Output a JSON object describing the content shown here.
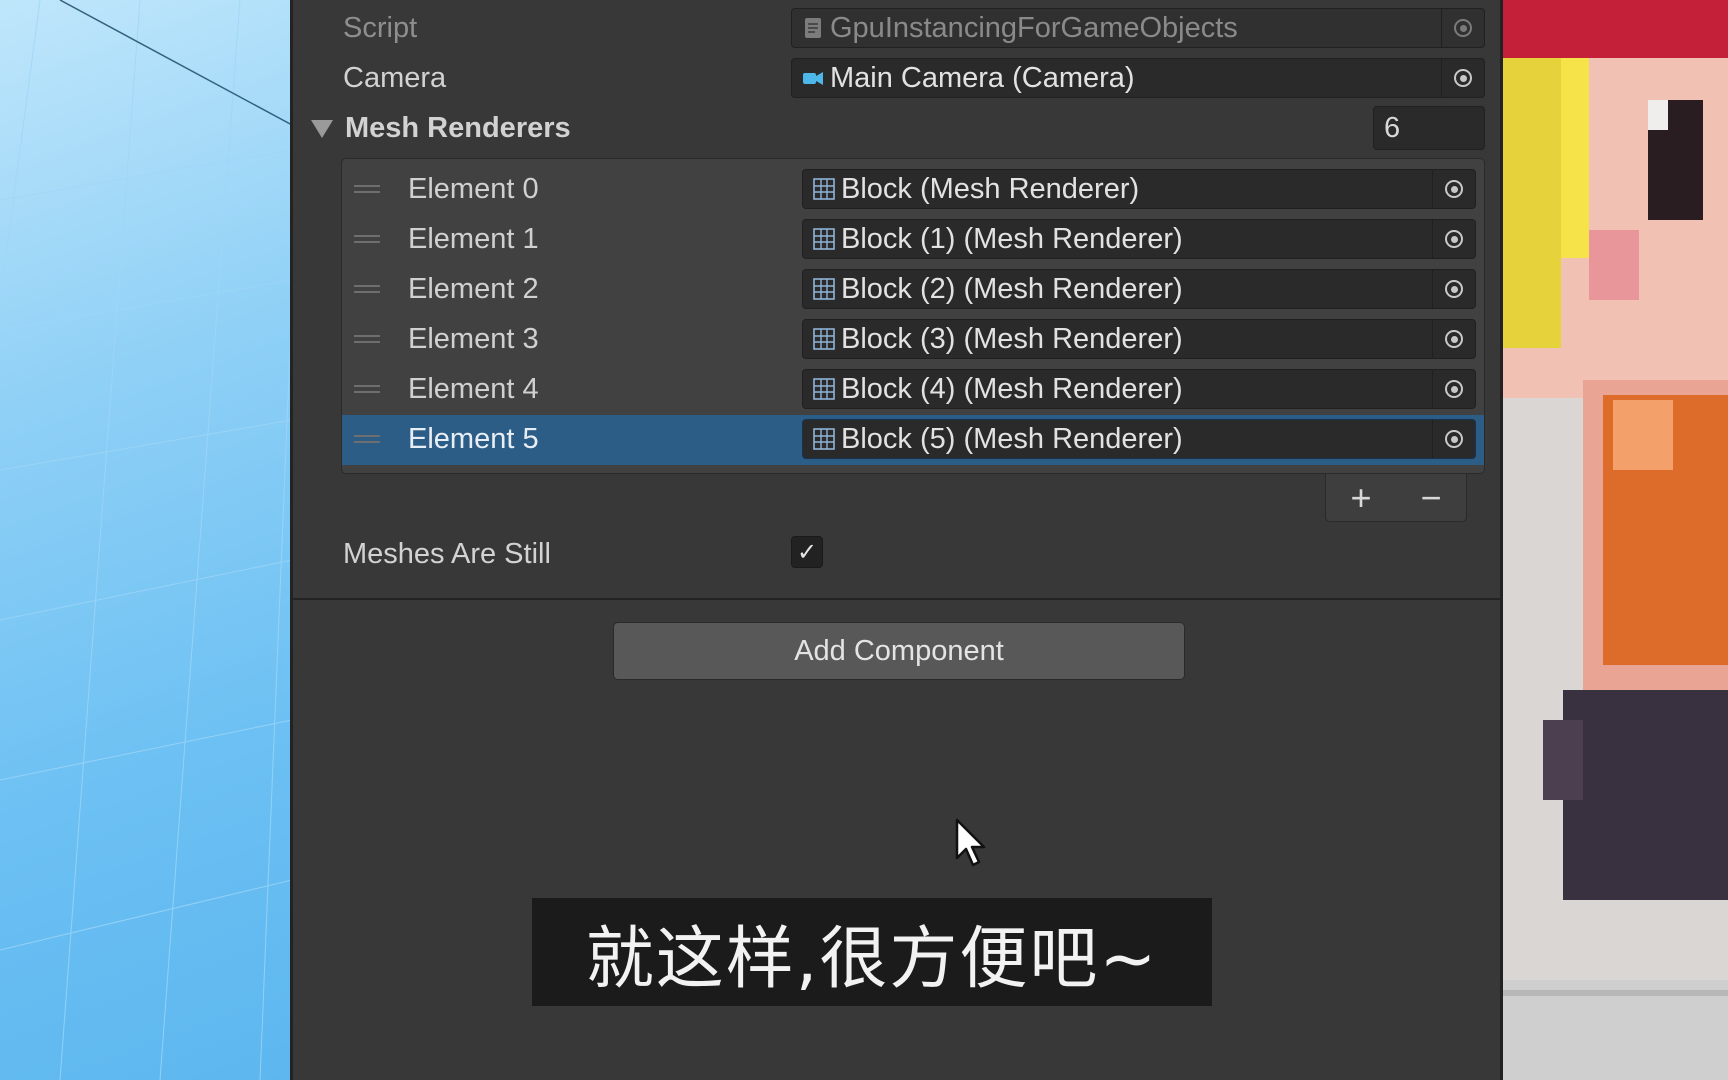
{
  "inspector": {
    "script": {
      "label": "Script",
      "value": "GpuInstancingForGameObjects",
      "icon": "script-file-icon"
    },
    "camera": {
      "label": "Camera",
      "value": "Main Camera (Camera)",
      "icon": "camera-icon"
    },
    "mesh_renderers": {
      "label": "Mesh Renderers",
      "count": "6",
      "elements": [
        {
          "label": "Element 0",
          "value": "Block (Mesh Renderer)"
        },
        {
          "label": "Element 1",
          "value": "Block (1) (Mesh Renderer)"
        },
        {
          "label": "Element 2",
          "value": "Block (2) (Mesh Renderer)"
        },
        {
          "label": "Element 3",
          "value": "Block (3) (Mesh Renderer)"
        },
        {
          "label": "Element 4",
          "value": "Block (4) (Mesh Renderer)"
        },
        {
          "label": "Element 5",
          "value": "Block (5) (Mesh Renderer)",
          "selected": true
        }
      ],
      "add_label": "+",
      "remove_label": "−"
    },
    "meshes_are_still": {
      "label": "Meshes Are Still",
      "checked": true,
      "check_glyph": "✓"
    },
    "add_component_label": "Add Component"
  },
  "subtitle": "就这样,很方便吧~",
  "colors": {
    "selection": "#2c5d87",
    "panel": "#383838",
    "field": "#2a2a2a"
  }
}
